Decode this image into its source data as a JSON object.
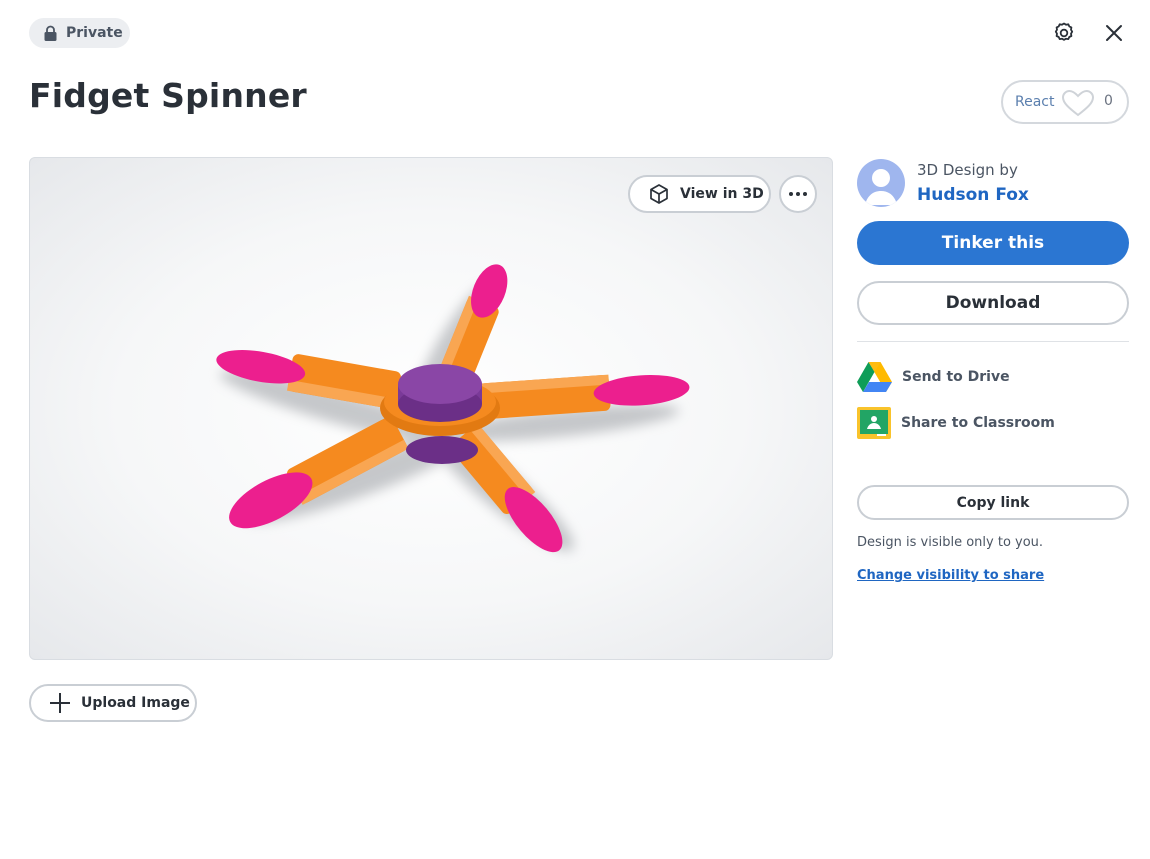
{
  "header": {
    "visibility_badge": "Private",
    "icons": {
      "lock": "lock-icon",
      "settings": "gear-icon",
      "close": "close-icon"
    }
  },
  "design": {
    "title": "Fidget Spinner",
    "react_label": "React",
    "react_count": "0"
  },
  "viewer": {
    "view_3d_label": "View in 3D",
    "colors": {
      "arm": "#f58a1f",
      "tip": "#ec1f8e",
      "hub": "#7a3a98"
    }
  },
  "author": {
    "byline": "3D Design by",
    "name": "Hudson Fox"
  },
  "actions": {
    "tinker": "Tinker this",
    "download": "Download",
    "send_to_drive": "Send to Drive",
    "share_classroom": "Share to Classroom",
    "copy_link": "Copy link",
    "visibility_note": "Design is visible only to you.",
    "change_visibility": "Change visibility to share",
    "upload_image": "Upload Image"
  },
  "colors": {
    "primary": "#2b76d2",
    "link": "#1f66c2"
  }
}
